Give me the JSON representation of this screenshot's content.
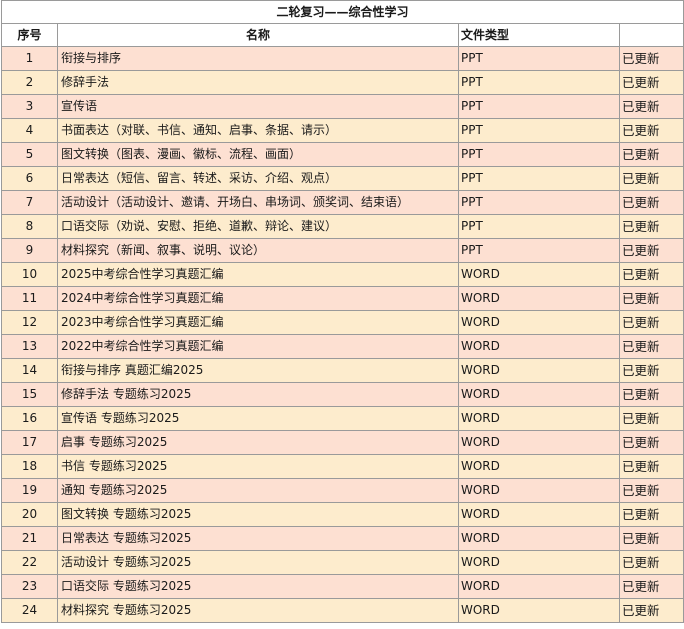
{
  "sheet": {
    "title": "二轮复习——综合性学习",
    "headers": {
      "index": "序号",
      "name": "名称",
      "type": "文件类型",
      "status": ""
    },
    "rows": [
      {
        "index": "1",
        "name": "衔接与排序",
        "type": "PPT",
        "status": "已更新"
      },
      {
        "index": "2",
        "name": "修辞手法",
        "type": "PPT",
        "status": "已更新"
      },
      {
        "index": "3",
        "name": "宣传语",
        "type": "PPT",
        "status": "已更新"
      },
      {
        "index": "4",
        "name": "书面表达（对联、书信、通知、启事、条据、请示）",
        "type": "PPT",
        "status": "已更新"
      },
      {
        "index": "5",
        "name": "图文转换（图表、漫画、徽标、流程、画面）",
        "type": "PPT",
        "status": "已更新"
      },
      {
        "index": "6",
        "name": "日常表达（短信、留言、转述、采访、介绍、观点）",
        "type": "PPT",
        "status": "已更新"
      },
      {
        "index": "7",
        "name": "活动设计（活动设计、邀请、开场白、串场词、颁奖词、结束语）",
        "type": "PPT",
        "status": "已更新"
      },
      {
        "index": "8",
        "name": "口语交际（劝说、安慰、拒绝、道歉、辩论、建议）",
        "type": "PPT",
        "status": "已更新"
      },
      {
        "index": "9",
        "name": "材料探究（新闻、叙事、说明、议论）",
        "type": "PPT",
        "status": "已更新"
      },
      {
        "index": "10",
        "name": "2025中考综合性学习真题汇编",
        "type": "WORD",
        "status": "已更新"
      },
      {
        "index": "11",
        "name": "2024中考综合性学习真题汇编",
        "type": "WORD",
        "status": "已更新"
      },
      {
        "index": "12",
        "name": "2023中考综合性学习真题汇编",
        "type": "WORD",
        "status": "已更新"
      },
      {
        "index": "13",
        "name": "2022中考综合性学习真题汇编",
        "type": "WORD",
        "status": "已更新"
      },
      {
        "index": "14",
        "name": "衔接与排序 真题汇编2025",
        "type": "WORD",
        "status": "已更新"
      },
      {
        "index": "15",
        "name": "修辞手法  专题练习2025",
        "type": "WORD",
        "status": "已更新"
      },
      {
        "index": "16",
        "name": "宣传语  专题练习2025",
        "type": "WORD",
        "status": "已更新"
      },
      {
        "index": "17",
        "name": "启事  专题练习2025",
        "type": "WORD",
        "status": "已更新"
      },
      {
        "index": "18",
        "name": "书信  专题练习2025",
        "type": "WORD",
        "status": "已更新"
      },
      {
        "index": "19",
        "name": "通知  专题练习2025",
        "type": "WORD",
        "status": "已更新"
      },
      {
        "index": "20",
        "name": "图文转换  专题练习2025",
        "type": "WORD",
        "status": "已更新"
      },
      {
        "index": "21",
        "name": "日常表达  专题练习2025",
        "type": "WORD",
        "status": "已更新"
      },
      {
        "index": "22",
        "name": "活动设计  专题练习2025",
        "type": "WORD",
        "status": "已更新"
      },
      {
        "index": "23",
        "name": "口语交际  专题练习2025",
        "type": "WORD",
        "status": "已更新"
      },
      {
        "index": "24",
        "name": "材料探究  专题练习2025",
        "type": "WORD",
        "status": "已更新"
      }
    ]
  },
  "colors": {
    "row_odd": "#fde0d2",
    "row_even": "#fdeccd",
    "grid": "#9a9a9a"
  }
}
